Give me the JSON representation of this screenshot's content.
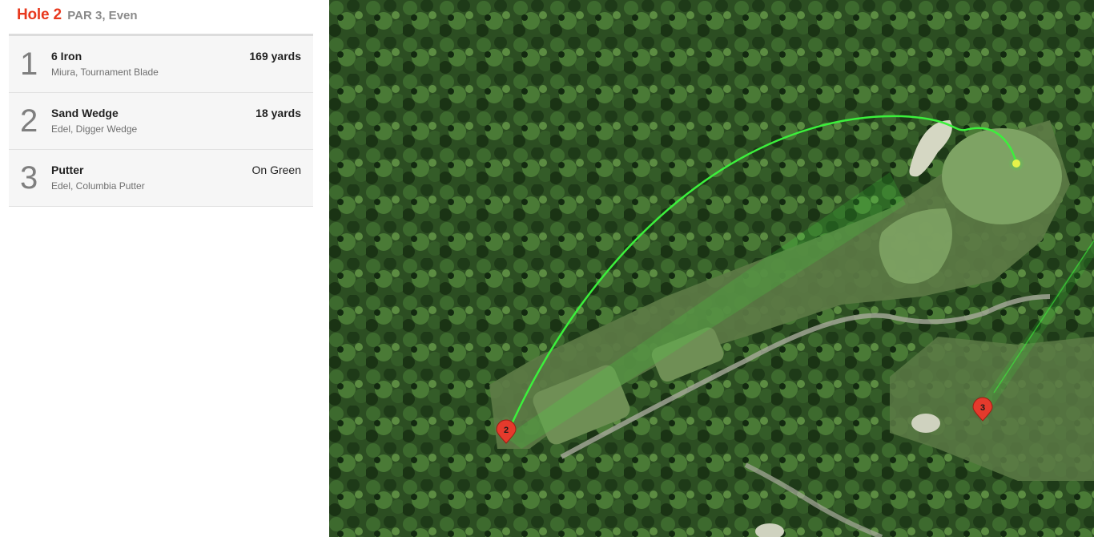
{
  "header": {
    "hole": "Hole 2",
    "details": "PAR 3, Even"
  },
  "shots": [
    {
      "number": "1",
      "club": "6 Iron",
      "model": "Miura, Tournament Blade",
      "distance": "169 yards"
    },
    {
      "number": "2",
      "club": "Sand Wedge",
      "model": "Edel, Digger Wedge",
      "distance": "18 yards"
    },
    {
      "number": "3",
      "club": "Putter",
      "model": "Edel, Columbia Putter",
      "distance": "On Green"
    }
  ],
  "map": {
    "pins": [
      {
        "label": "2",
        "color": "#e53a2c"
      },
      {
        "label": "3",
        "color": "#e53a2c"
      }
    ],
    "shot_line_color": "#3cf03c",
    "ball_color": "#e6f24a"
  },
  "colors": {
    "accent": "#e8381d",
    "pin": "#e53a2c",
    "trace": "#3cf03c"
  }
}
